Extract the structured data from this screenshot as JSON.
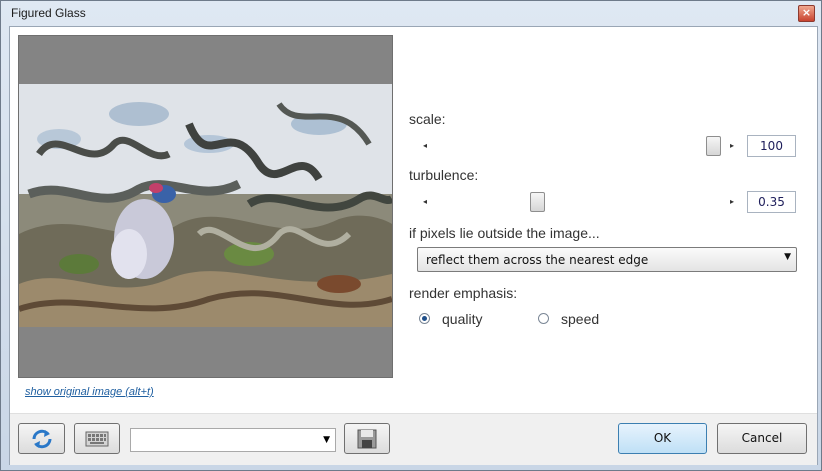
{
  "window": {
    "title": "Figured Glass",
    "close_label": "×"
  },
  "preview": {
    "show_original_link": "show original image (alt+t)"
  },
  "scale": {
    "label": "scale:",
    "value": "100",
    "level": 1.0
  },
  "turbulence": {
    "label": "turbulence:",
    "value": "0.35",
    "level": 0.35
  },
  "edge": {
    "label": "if pixels lie outside the image...",
    "selected": "reflect them across the nearest edge"
  },
  "render": {
    "label": "render emphasis:",
    "options": [
      "quality",
      "speed"
    ],
    "selected": "quality"
  },
  "buttons": {
    "ok": "OK",
    "cancel": "Cancel"
  },
  "icons": [
    "refresh-icon",
    "keyboard-icon",
    "save-preset-icon"
  ],
  "colors": {
    "accent": "#1f4f8a",
    "ok_face": "#cfe6f7"
  }
}
